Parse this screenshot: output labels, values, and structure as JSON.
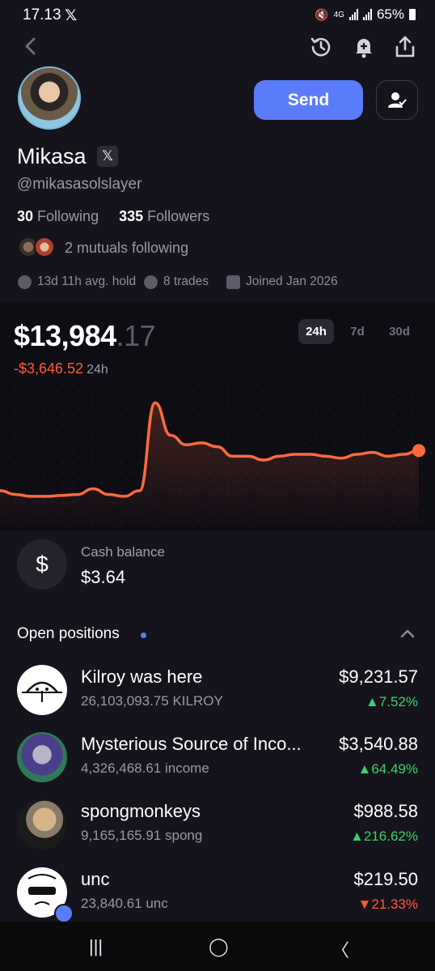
{
  "status_bar": {
    "time": "17.13",
    "network": "4G",
    "battery": "65%"
  },
  "profile": {
    "name": "Mikasa",
    "x_badge": "𝕏",
    "handle": "@mikasasolslayer",
    "following_count": "30",
    "following_label": "Following",
    "followers_count": "335",
    "followers_label": "Followers",
    "mutuals": "2 mutuals following",
    "avg_hold": "13d 11h avg. hold",
    "trades": "8 trades",
    "joined": "Joined Jan 2026"
  },
  "actions": {
    "send_label": "Send"
  },
  "portfolio": {
    "value_main": "$13,984",
    "value_cents": ".17",
    "change": "-$3,646.52",
    "change_period": "24h",
    "ranges": [
      "24h",
      "7d",
      "30d"
    ],
    "selected_range": "24h",
    "line_color": "#ff6a3d"
  },
  "chart_data": {
    "type": "line",
    "title": "",
    "xlabel": "",
    "ylabel": "",
    "series": [
      {
        "values": [
          12.4,
          12.2,
          12.1,
          12.1,
          12.15,
          12.2,
          12.5,
          12.2,
          12.1,
          12.4,
          17.0,
          15.3,
          14.8,
          14.9,
          14.7,
          14.2,
          14.2,
          14.0,
          14.2,
          14.3,
          14.3,
          14.2,
          14.1,
          14.3,
          14.4,
          14.2,
          14.3,
          14.5
        ]
      }
    ],
    "grid": false,
    "end_marker": true
  },
  "cash": {
    "icon": "$",
    "label": "Cash balance",
    "value": "$3.64"
  },
  "positions": {
    "title": "Open positions",
    "items": [
      {
        "name": "Kilroy was here",
        "qty": "26,103,093.75 KILROY",
        "value": "$9,231.57",
        "change": "▲7.52%",
        "dir": "up"
      },
      {
        "name": "Mysterious Source of Inco...",
        "qty": "4,326,468.61 income",
        "value": "$3,540.88",
        "change": "▲64.49%",
        "dir": "up"
      },
      {
        "name": "spongmonkeys",
        "qty": "9,165,165.91 spong",
        "value": "$988.58",
        "change": "▲216.62%",
        "dir": "up"
      },
      {
        "name": "unc",
        "qty": "23,840.61 unc",
        "value": "$219.50",
        "change": "▼21.33%",
        "dir": "down"
      }
    ]
  },
  "bottom_nav": {
    "recents": "|||",
    "home": "◯",
    "back": "〈"
  }
}
